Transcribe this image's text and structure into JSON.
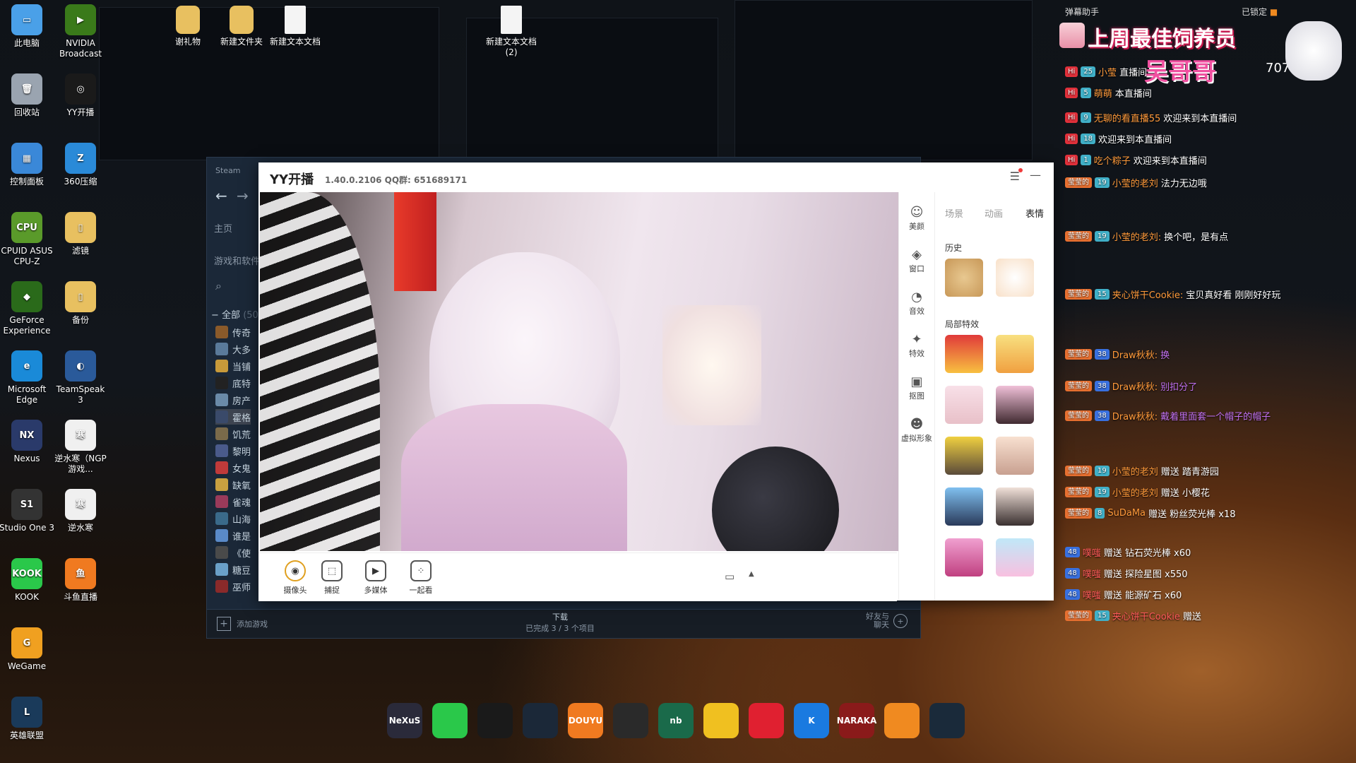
{
  "desktop": {
    "icons_col1": [
      {
        "label": "此电脑",
        "icon": "computer-icon",
        "color": "#4aa0e8",
        "glyph": "▭"
      },
      {
        "label": "回收站",
        "icon": "recycle-bin-icon",
        "color": "#9aa4b0",
        "glyph": "🗑"
      },
      {
        "label": "控制面板",
        "icon": "control-panel-icon",
        "color": "#3a88d8",
        "glyph": "▦"
      },
      {
        "label": "CPUID ASUS CPU-Z",
        "icon": "cpuz-icon",
        "color": "#5a9a2a",
        "glyph": "CPU"
      },
      {
        "label": "GeForce Experience",
        "icon": "geforce-icon",
        "color": "#2a6a1a",
        "glyph": "◆"
      },
      {
        "label": "Microsoft Edge",
        "icon": "edge-icon",
        "color": "#1a8ad8",
        "glyph": "e"
      },
      {
        "label": "Nexus",
        "icon": "nexus-icon",
        "color": "#2a3a6a",
        "glyph": "NX"
      },
      {
        "label": "Studio One 3",
        "icon": "studio-one-icon",
        "color": "#333333",
        "glyph": "S1"
      },
      {
        "label": "KOOK",
        "icon": "kook-icon",
        "color": "#2ac84a",
        "glyph": "KOOK"
      },
      {
        "label": "WeGame",
        "icon": "wegame-icon",
        "color": "#f0a020",
        "glyph": "G"
      },
      {
        "label": "英雄联盟",
        "icon": "league-icon",
        "color": "#1a3a5a",
        "glyph": "L"
      }
    ],
    "icons_col2": [
      {
        "label": "NVIDIA Broadcast",
        "icon": "nvidia-broadcast-icon",
        "color": "#3a7a1a",
        "glyph": "▶"
      },
      {
        "label": "YY开播",
        "icon": "yy-live-icon",
        "color": "#1a1a1a",
        "glyph": "◎"
      },
      {
        "label": "360压缩",
        "icon": "360zip-icon",
        "color": "#2a8ad8",
        "glyph": "Z"
      },
      {
        "label": "滤镜",
        "icon": "folder-filter-icon",
        "color": "#e8c060",
        "glyph": "▯"
      },
      {
        "label": "备份",
        "icon": "folder-backup-icon",
        "color": "#e8c060",
        "glyph": "▯"
      },
      {
        "label": "TeamSpeak 3",
        "icon": "teamspeak-icon",
        "color": "#2a5a9a",
        "glyph": "◐"
      },
      {
        "label": "逆水寒（NGP游戏...",
        "icon": "nishuihan-ngp-icon",
        "color": "#f0f0f0",
        "glyph": "寒"
      },
      {
        "label": "逆水寒",
        "icon": "nishuihan-icon",
        "color": "#f0f0f0",
        "glyph": "寒"
      },
      {
        "label": "斗鱼直播",
        "icon": "douyu-icon",
        "color": "#f07a20",
        "glyph": "鱼"
      }
    ],
    "top_icons": [
      {
        "label": "谢礼物",
        "icon": "folder-gift-icon"
      },
      {
        "label": "新建文件夹",
        "icon": "new-folder-icon"
      },
      {
        "label": "新建文本文档",
        "icon": "text-doc-icon"
      },
      {
        "label": "新建文本文档\n(2)",
        "icon": "text-doc-2-icon"
      }
    ]
  },
  "steam": {
    "title": "Steam",
    "home": "主页",
    "section": "游戏和软件",
    "all_label": "全部",
    "all_count": "(50",
    "games": [
      "传奇",
      "大多",
      "当铺",
      "底特",
      "房产",
      "霍格",
      "饥荒",
      "黎明",
      "女鬼",
      "缺氧",
      "雀魂",
      "山海",
      "谁是",
      "《使",
      "糖豆",
      "巫师"
    ],
    "add_game": "添加游戏",
    "download_label": "下载",
    "download_status": "已完成 3 / 3 个项目",
    "friends_chat": "好友与\n聊天"
  },
  "yy": {
    "title": "YY开播",
    "version": "1.40.0.2106  QQ群: 651689171",
    "toolbar": [
      {
        "label": "摄像头",
        "icon": "camera-icon",
        "glyph": "◉"
      },
      {
        "label": "捕捉",
        "icon": "capture-icon",
        "glyph": "⬚"
      },
      {
        "label": "多媒体",
        "icon": "multimedia-icon",
        "glyph": "▶"
      },
      {
        "label": "一起看",
        "icon": "watch-together-icon",
        "glyph": "⁘"
      }
    ],
    "side_tools": [
      {
        "label": "美颜",
        "icon": "beauty-icon",
        "glyph": "☺"
      },
      {
        "label": "窗口",
        "icon": "window-layers-icon",
        "glyph": "◈"
      },
      {
        "label": "音效",
        "icon": "sound-effect-icon",
        "glyph": "◔"
      },
      {
        "label": "特效",
        "icon": "effects-icon",
        "glyph": "✦"
      },
      {
        "label": "抠图",
        "icon": "cutout-icon",
        "glyph": "▣"
      },
      {
        "label": "虚拟形象",
        "icon": "avatar-icon",
        "glyph": "☻"
      }
    ],
    "fx_tabs": [
      "场景",
      "动画",
      "表情"
    ],
    "history_label": "历史",
    "local_fx_label": "局部特效"
  },
  "danmaku": {
    "assistant_title": "弹幕助手",
    "locked": "已锁定",
    "banner_title": "上周最佳饲养员",
    "banner_name": "吴哥哥",
    "banner_number": "707",
    "lines": [
      {
        "badge": "Hi",
        "fan": "",
        "lv": "25",
        "name": "小莹",
        "text": "直播间"
      },
      {
        "badge": "Hi",
        "fan": "",
        "lv": "5",
        "name": "萌萌",
        "text": "本直播间"
      },
      {
        "badge": "Hi",
        "fan": "",
        "lv": "9",
        "name": "无聊的看直播55",
        "text": "欢迎来到本直播间"
      },
      {
        "badge": "Hi",
        "fan": "",
        "lv": "18",
        "name": "",
        "text": "欢迎来到本直播间"
      },
      {
        "badge": "Hi",
        "fan": "",
        "lv": "1",
        "name": "吃个粽子",
        "text": "欢迎来到本直播间"
      },
      {
        "badge": "",
        "fan": "莹莹的",
        "lv": "19",
        "name": "小莹的老刘",
        "text": "法力无边哦"
      },
      {
        "badge": "",
        "fan": "莹莹的",
        "lv": "19",
        "name": "小莹的老刘:",
        "text": "换个吧，是有点"
      },
      {
        "badge": "",
        "fan": "莹莹的",
        "lv": "15",
        "name": "夹心饼干Cookie:",
        "text": "宝贝真好看 刚刚好好玩"
      },
      {
        "badge": "",
        "fan": "莹莹的",
        "lv": "38",
        "name": "Draw秋秋:",
        "text": "换"
      },
      {
        "badge": "",
        "fan": "莹莹的",
        "lv": "38",
        "name": "Draw秋秋:",
        "text": "别扣分了"
      },
      {
        "badge": "",
        "fan": "莹莹的",
        "lv": "38",
        "name": "Draw秋秋:",
        "text": "戴着里面套一个帽子的帽子"
      },
      {
        "badge": "",
        "fan": "莹莹的",
        "lv": "19",
        "name": "小莹的老刘",
        "text": "赠送 踏青游园"
      },
      {
        "badge": "",
        "fan": "莹莹的",
        "lv": "19",
        "name": "小莹的老刘",
        "text": "赠送 小樱花"
      },
      {
        "badge": "",
        "fan": "莹莹的",
        "lv": "8",
        "name": "SuDaMa",
        "text": "赠送 粉丝荧光棒 x18"
      },
      {
        "badge": "",
        "fan": "",
        "lv": "48",
        "name": "噗嗤",
        "text": "赠送 钻石荧光棒 x60"
      },
      {
        "badge": "",
        "fan": "",
        "lv": "48",
        "name": "噗嗤",
        "text": "赠送 探险星图 x550"
      },
      {
        "badge": "",
        "fan": "",
        "lv": "48",
        "name": "噗嗤",
        "text": "赠送 能源矿石 x60"
      },
      {
        "badge": "",
        "fan": "莹莹的",
        "lv": "15",
        "name": "夹心饼干Cookie",
        "text": "赠送"
      }
    ]
  },
  "taskbar": [
    {
      "label": "NeXuS",
      "icon": "nexus-dock-icon",
      "color": "#2a2a3a"
    },
    {
      "label": "",
      "icon": "wechat-icon",
      "color": "#2ac84a"
    },
    {
      "label": "",
      "icon": "qq-icon",
      "color": "#1a1a1a"
    },
    {
      "label": "",
      "icon": "steam-icon",
      "color": "#1b2838"
    },
    {
      "label": "DOUYU",
      "icon": "douyu-dock-icon",
      "color": "#f07a20"
    },
    {
      "label": "",
      "icon": "obs-stripe-icon",
      "color": "#2a2a2a"
    },
    {
      "label": "nb",
      "icon": "nb-icon",
      "color": "#1a6a4a"
    },
    {
      "label": "",
      "icon": "cat-app-icon",
      "color": "#f0c020"
    },
    {
      "label": "",
      "icon": "netease-music-icon",
      "color": "#e02030"
    },
    {
      "label": "K",
      "icon": "kugou-icon",
      "color": "#1a7ae0"
    },
    {
      "label": "NARAKA",
      "icon": "naraka-icon",
      "color": "#8a1a1a"
    },
    {
      "label": "",
      "icon": "orange-app-icon",
      "color": "#f08a20"
    },
    {
      "label": "",
      "icon": "teal-ring-icon",
      "color": "#1a2a3a"
    }
  ]
}
